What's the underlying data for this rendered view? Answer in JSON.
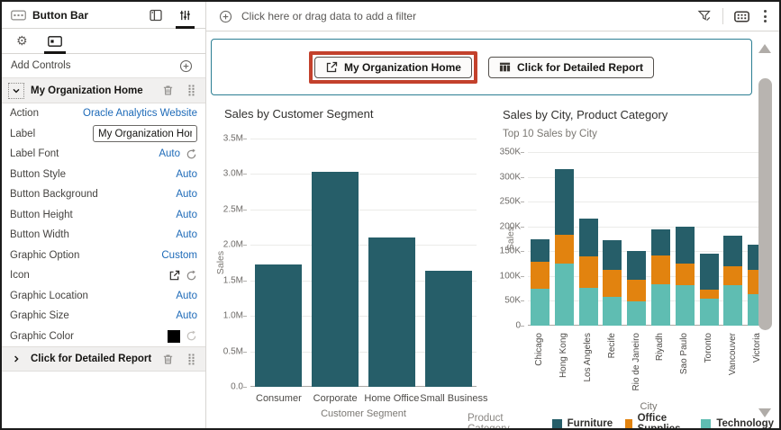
{
  "colors": {
    "selection_teal": "#2b7e93",
    "highlight_red": "#c3412c",
    "link_blue": "#1d6ab8",
    "furniture": "#265e69",
    "office_supplies": "#e2830f",
    "technology": "#5fbdb2"
  },
  "panel": {
    "title": "Button Bar",
    "title_icon": "button-bar-icon",
    "header_icons": [
      "grammar-panel-icon",
      "properties-sliders-icon"
    ],
    "tab_icons": [
      "gear-icon",
      "controls-icon"
    ],
    "add_controls": "Add Controls",
    "add_icon": "circle-plus-icon",
    "section1": {
      "label": "My Organization Home",
      "expanded": true,
      "row_icons": [
        "chevron-down-icon",
        "trash-icon",
        "drag-grip-icon"
      ],
      "properties": [
        {
          "label": "Action",
          "value": "Oracle Analytics Website",
          "widget": "link"
        },
        {
          "label": "Label",
          "value": "My Organization Hom",
          "widget": "input"
        },
        {
          "label": "Label Font",
          "value": "Auto",
          "widget": "value",
          "reset": true
        },
        {
          "label": "Button Style",
          "value": "Auto",
          "widget": "value"
        },
        {
          "label": "Button Background",
          "value": "Auto",
          "widget": "value"
        },
        {
          "label": "Button Height",
          "value": "Auto",
          "widget": "value"
        },
        {
          "label": "Button Width",
          "value": "Auto",
          "widget": "value"
        },
        {
          "label": "Graphic Option",
          "value": "Custom",
          "widget": "value"
        },
        {
          "label": "Icon",
          "value": "open-in-new-icon",
          "widget": "icon",
          "reset": true
        },
        {
          "label": "Graphic Location",
          "value": "Auto",
          "widget": "value"
        },
        {
          "label": "Graphic Size",
          "value": "Auto",
          "widget": "value"
        },
        {
          "label": "Graphic Color",
          "value": "#000000",
          "widget": "swatch",
          "reset": true
        }
      ]
    },
    "section2": {
      "label": "Click for Detailed Report",
      "expanded": false,
      "row_icons": [
        "chevron-right-icon",
        "trash-icon",
        "drag-grip-icon"
      ]
    }
  },
  "filter_bar": {
    "placeholder": "Click here or drag data to add a filter",
    "left_icon": "circle-plus-icon",
    "right_icons": [
      "filter-funnel-icon",
      "button-bar-icon",
      "menu-kebab-icon"
    ]
  },
  "button_bar": {
    "buttons": [
      {
        "label": "My Organization Home",
        "icon": "open-in-new-icon",
        "highlighted": true
      },
      {
        "label": "Click for Detailed Report",
        "icon": "table-icon",
        "highlighted": false
      }
    ]
  },
  "chart_data": [
    {
      "type": "bar",
      "title": "Sales by Customer Segment",
      "xlabel": "Customer Segment",
      "ylabel": "Sales",
      "categories": [
        "Consumer",
        "Corporate",
        "Home Office",
        "Small Business"
      ],
      "values": [
        1.72,
        3.03,
        2.1,
        1.63
      ],
      "unit": "M",
      "ylim": [
        0,
        3.5
      ],
      "ytick_labels": [
        "0.0",
        "0.5M",
        "1.0M",
        "1.5M",
        "2.0M",
        "2.5M",
        "3.0M",
        "3.5M"
      ],
      "bar_color": "#265e69",
      "grid": true,
      "legend_position": "none"
    },
    {
      "type": "stacked-bar",
      "title": "Sales by City, Product Category",
      "subtitle": "Top 10 Sales by City",
      "xlabel": "City",
      "ylabel": "Sales",
      "categories": [
        "Chicago",
        "Hong Kong",
        "Los Angeles",
        "Recife",
        "Rio de Janeiro",
        "Riyadh",
        "Sao Paulo",
        "Toronto",
        "Vancouver",
        "Victoria"
      ],
      "series": [
        {
          "name": "Technology",
          "color": "#5fbdb2",
          "values": [
            75,
            126,
            77,
            58,
            49,
            84,
            81,
            55,
            81,
            64
          ]
        },
        {
          "name": "Office Supplies",
          "color": "#e2830f",
          "values": [
            53,
            58,
            63,
            55,
            43,
            57,
            44,
            18,
            39,
            49
          ]
        },
        {
          "name": "Furniture",
          "color": "#265e69",
          "values": [
            47,
            131,
            75,
            59,
            59,
            53,
            75,
            73,
            62,
            50
          ]
        }
      ],
      "stack_order": "bottom-to-top",
      "unit": "K",
      "ylim": [
        0,
        350
      ],
      "ytick_labels": [
        "0",
        "50K",
        "100K",
        "150K",
        "200K",
        "250K",
        "300K",
        "350K"
      ],
      "grid": true,
      "legend": {
        "title": "Product Category",
        "position": "bottom",
        "entries": [
          {
            "label": "Furniture",
            "color": "#265e69"
          },
          {
            "label": "Office Supplies",
            "color": "#e2830f"
          },
          {
            "label": "Technology",
            "color": "#5fbdb2"
          }
        ]
      }
    }
  ]
}
